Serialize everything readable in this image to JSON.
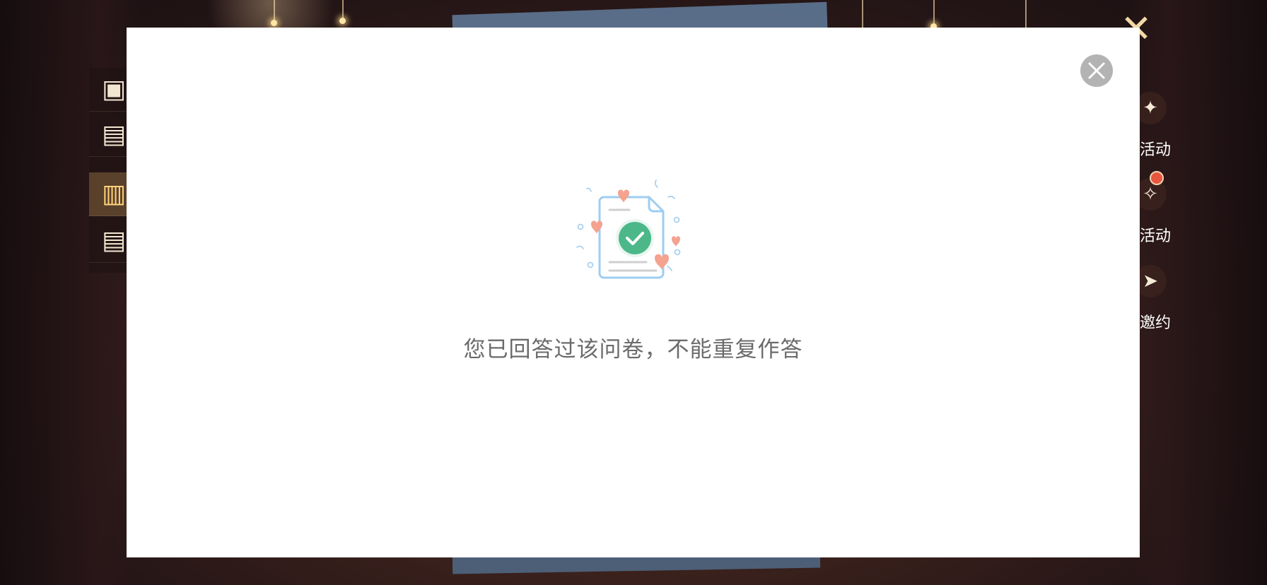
{
  "background": {
    "right_menu": {
      "items": [
        {
          "label": "活动",
          "icon": "gift-bag-icon",
          "badge": false
        },
        {
          "label": "活动",
          "icon": "lantern-icon",
          "badge": true
        },
        {
          "label": "邀约",
          "icon": "paper-plane-icon",
          "badge": false
        }
      ]
    },
    "left_menu": {
      "items": [
        {
          "icon": "treasure-chest-icon",
          "active": false
        },
        {
          "icon": "gift-box-icon",
          "active": false
        },
        {
          "icon": "scroll-icon",
          "active": true
        },
        {
          "icon": "gift-box-icon",
          "active": false
        }
      ]
    },
    "top_right_emblem_icon": "crossed-swords-icon"
  },
  "dialog": {
    "message": "您已回答过该问卷，不能重复作答",
    "illustration_icon": "document-check-icon",
    "close_icon": "close-icon",
    "colors": {
      "check_green": "#4cb88a",
      "document_blue": "#9fcdf0",
      "heart_pink": "#f3a38f",
      "close_gray": "#b3b3b3",
      "text_gray": "#6b6b6b"
    }
  }
}
